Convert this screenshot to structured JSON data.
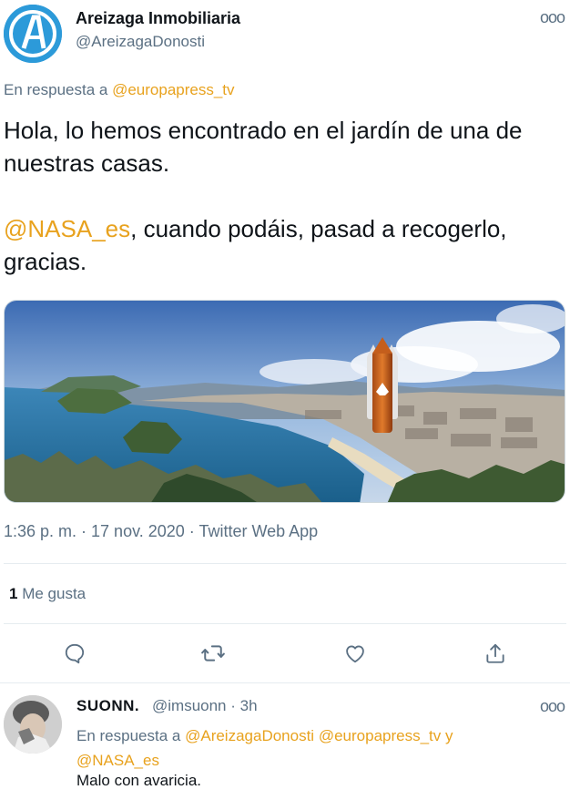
{
  "tweet": {
    "author_name": "Areizaga Inmobiliaria",
    "author_handle": "@AreizagaDonosti",
    "reply_prefix": "En respuesta a",
    "reply_handle": "@europapress_tv",
    "text_line1": "Hola, lo hemos encontrado en el jardín de una de nuestras casas.",
    "mention": "@NASA_es",
    "text_line2_rest": ", cuando podáis, pasad a recogerlo, gracias.",
    "timestamp": "1:36 p. m. · 17 nov. 2020 · Twitter Web App",
    "likes_count": "1",
    "likes_label": "Me gusta",
    "more_symbol": "ooo"
  },
  "reply": {
    "author_name": "SUONN.",
    "author_handle": "@imsuonn · 3h",
    "reply_prefix": "En respuesta a",
    "reply_handle1": "@AreizagaDonosti",
    "reply_handle2": "@europapress_tv",
    "reply_conj": "y",
    "reply_handle3": "@NASA_es",
    "text": "Malo con avaricia.",
    "more_symbol": "ooo"
  },
  "icons": {
    "reply": "reply-icon",
    "retweet": "retweet-icon",
    "like": "heart-icon",
    "share": "share-icon"
  },
  "colors": {
    "accent": "#e8a21e",
    "secondary_text": "#5b7083",
    "avatar_blue": "#2c9ad9"
  }
}
